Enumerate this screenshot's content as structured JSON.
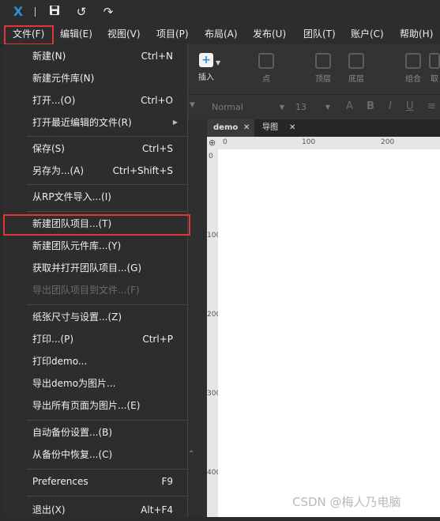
{
  "menubar": {
    "file": "文件(F)",
    "edit": "编辑(E)",
    "view": "视图(V)",
    "project": "项目(P)",
    "layout": "布局(A)",
    "publish": "发布(U)",
    "team": "团队(T)",
    "account": "账户(C)",
    "help": "帮助(H)"
  },
  "toolbar": {
    "insert_label": "插入",
    "point_label": "点",
    "top_label": "顶层",
    "bottom_label": "底层",
    "group_label": "组合",
    "cut_label": "取"
  },
  "formatbar": {
    "style_value": "Normal",
    "size_value": "13"
  },
  "tabs": [
    {
      "label": "demo"
    },
    {
      "label": "导图"
    }
  ],
  "ruler": {
    "h": [
      "0",
      "100",
      "200"
    ],
    "v": [
      "0",
      "100",
      "200",
      "300",
      "400"
    ]
  },
  "file_menu": {
    "new": {
      "label": "新建(N)",
      "shortcut": "Ctrl+N"
    },
    "new_library": {
      "label": "新建元件库(N)"
    },
    "open": {
      "label": "打开...(O)",
      "shortcut": "Ctrl+O"
    },
    "recent": {
      "label": "打开最近编辑的文件(R)"
    },
    "save": {
      "label": "保存(S)",
      "shortcut": "Ctrl+S"
    },
    "save_as": {
      "label": "另存为...(A)",
      "shortcut": "Ctrl+Shift+S"
    },
    "import_rp": {
      "label": "从RP文件导入...(I)"
    },
    "new_team_project": {
      "label": "新建团队项目...(T)"
    },
    "new_team_library": {
      "label": "新建团队元件库...(Y)"
    },
    "get_team_project": {
      "label": "获取并打开团队项目...(G)"
    },
    "export_team_project": {
      "label": "导出团队项目到文件...(F)"
    },
    "page_setup": {
      "label": "纸张尺寸与设置...(Z)"
    },
    "print": {
      "label": "打印...(P)",
      "shortcut": "Ctrl+P"
    },
    "print_demo": {
      "label": "打印demo..."
    },
    "export_demo_image": {
      "label": "导出demo为图片..."
    },
    "export_all_images": {
      "label": "导出所有页面为图片...(E)"
    },
    "autobackup_settings": {
      "label": "自动备份设置...(B)"
    },
    "restore_backup": {
      "label": "从备份中恢复...(C)"
    },
    "preferences": {
      "label": "Preferences",
      "shortcut": "F9"
    },
    "exit": {
      "label": "退出(X)",
      "shortcut": "Alt+F4"
    }
  },
  "watermark": "CSDN @梅人乃电脑",
  "colors": {
    "highlight": "#e0353b",
    "accent": "#2e8fd8"
  }
}
